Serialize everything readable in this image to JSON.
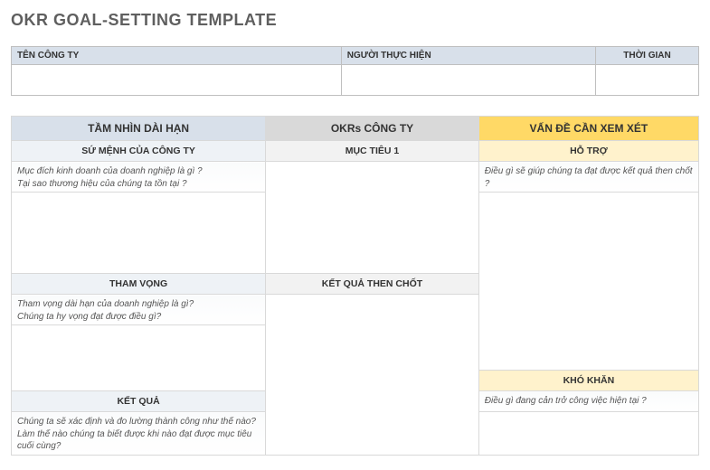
{
  "title": "OKR GOAL-SETTING TEMPLATE",
  "top": {
    "company_label": "TÊN CÔNG TY",
    "performer_label": "NGƯỜI THỰC HIỆN",
    "timeframe_label": "THỜI GIAN",
    "company_value": "",
    "performer_value": "",
    "timeframe_value": ""
  },
  "columns": {
    "vision": "TẦM NHÌN DÀI HẠN",
    "okrs": "OKRs CÔNG TY",
    "issues": "VẤN ĐỀ CẦN XEM XÉT"
  },
  "sections": {
    "mission": {
      "label": "SỨ MỆNH CỦA CÔNG TY",
      "prompt": "Mục đích kinh doanh của doanh nghiệp là gì ?\nTại sao thương hiệu của chúng ta tồn tại ?"
    },
    "objective1": {
      "label": "MỤC TIÊU 1"
    },
    "support": {
      "label": "HỖ TRỢ",
      "prompt": "Điều gì sẽ giúp chúng ta đạt được kết quả then chốt ?"
    },
    "ambition": {
      "label": "THAM VỌNG",
      "prompt": "Tham vọng dài hạn của doanh nghiệp là gì?\nChúng ta hy vọng đạt được điều gì?"
    },
    "key_results": {
      "label": "KẾT QUẢ THEN CHỐT"
    },
    "obstacles": {
      "label": "KHÓ KHĂN",
      "prompt": "Điều gì đang cản trở công việc hiện tại ?"
    },
    "results": {
      "label": "KẾT QUẢ",
      "prompt": "Chúng ta sẽ xác định và đo lường thành công như thế nào? Làm thế nào chúng ta biết được khi nào đạt được mục tiêu cuối cùng?"
    }
  }
}
